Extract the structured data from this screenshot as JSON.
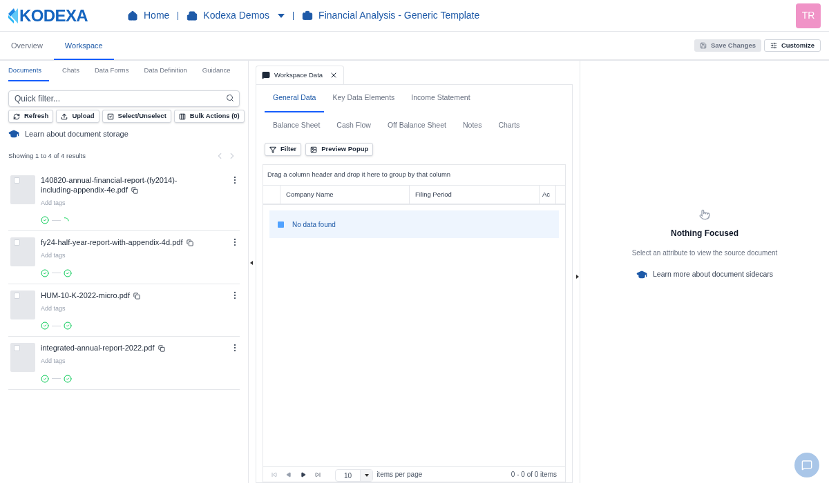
{
  "header": {
    "logo": "KODEXA",
    "breadcrumbs": [
      {
        "label": "Home",
        "kind": "home",
        "dropdown": false
      },
      {
        "label": "Kodexa Demos",
        "kind": "organization",
        "dropdown": true
      },
      {
        "label": "Financial Analysis - Generic Template",
        "kind": "project",
        "dropdown": false
      }
    ],
    "avatar": "TR"
  },
  "main_tabs": [
    {
      "label": "Overview",
      "selected": false
    },
    {
      "label": "Workspace",
      "selected": true
    }
  ],
  "actions": [
    {
      "label": "Save Changes",
      "kind": "save",
      "disabled": true
    },
    {
      "label": "Customize",
      "kind": "customize",
      "disabled": false
    }
  ],
  "left": {
    "tabs": [
      {
        "label": "Documents",
        "selected": true
      },
      {
        "label": "Chats",
        "selected": false
      },
      {
        "label": "Data Forms",
        "selected": false
      },
      {
        "label": "Data Definition",
        "selected": false
      },
      {
        "label": "Guidance",
        "selected": false
      }
    ],
    "filter": {
      "placeholder": "Quick filter..."
    },
    "buttons": [
      {
        "label": "Refresh",
        "kind": "refresh"
      },
      {
        "label": "Upload",
        "kind": "upload"
      },
      {
        "label": "Select/Unselect",
        "kind": "select"
      },
      {
        "label": "Bulk Actions (0)",
        "kind": "bulk"
      }
    ],
    "learn_link": "Learn about document storage",
    "results": "Showing 1 to 4 of 4 results",
    "documents": [
      {
        "name": "140820-annual-financial-report-(fy2014)-including-appendix-4e.pdf",
        "checked": false,
        "tags_placeholder": "Add tags",
        "steps": [
          {
            "kind": "done"
          },
          {
            "kind": "pending"
          }
        ]
      },
      {
        "name": "fy24-half-year-report-with-appendix-4d.pdf",
        "checked": false,
        "tags_placeholder": "Add tags",
        "steps": [
          {
            "kind": "done"
          },
          {
            "kind": "done"
          }
        ]
      },
      {
        "name": "HUM-10-K-2022-micro.pdf",
        "checked": false,
        "tags_placeholder": "Add tags",
        "steps": [
          {
            "kind": "done"
          },
          {
            "kind": "done"
          }
        ]
      },
      {
        "name": "integrated-annual-report-2022.pdf",
        "checked": false,
        "tags_placeholder": "Add tags",
        "steps": [
          {
            "kind": "done"
          },
          {
            "kind": "done"
          }
        ]
      }
    ]
  },
  "center": {
    "panel_tab": "Workspace Data",
    "data_tabs": [
      [
        {
          "label": "General Data",
          "selected": true
        },
        {
          "label": "Key Data Elements",
          "selected": false
        },
        {
          "label": "Income Statement",
          "selected": false
        }
      ],
      [
        {
          "label": "Balance Sheet",
          "selected": false
        },
        {
          "label": "Cash Flow",
          "selected": false
        },
        {
          "label": "Off Balance Sheet",
          "selected": false
        },
        {
          "label": "Notes",
          "selected": false
        },
        {
          "label": "Charts",
          "selected": false
        }
      ]
    ],
    "toolbar": [
      {
        "label": "Filter",
        "kind": "filter"
      },
      {
        "label": "Preview Popup",
        "kind": "preview"
      }
    ],
    "group_hint": "Drag a column header and drop it here to group by that column",
    "columns": [
      "Company Name",
      "Filing Period",
      "Ac"
    ],
    "empty_message": "No data found",
    "pager": {
      "page_size": "10",
      "per_page_label": "items per page",
      "summary": "0 - 0 of 0 items"
    }
  },
  "right": {
    "title": "Nothing Focused",
    "subtitle": "Select an attribute to view the source document",
    "link": "Learn more about document sidecars"
  }
}
